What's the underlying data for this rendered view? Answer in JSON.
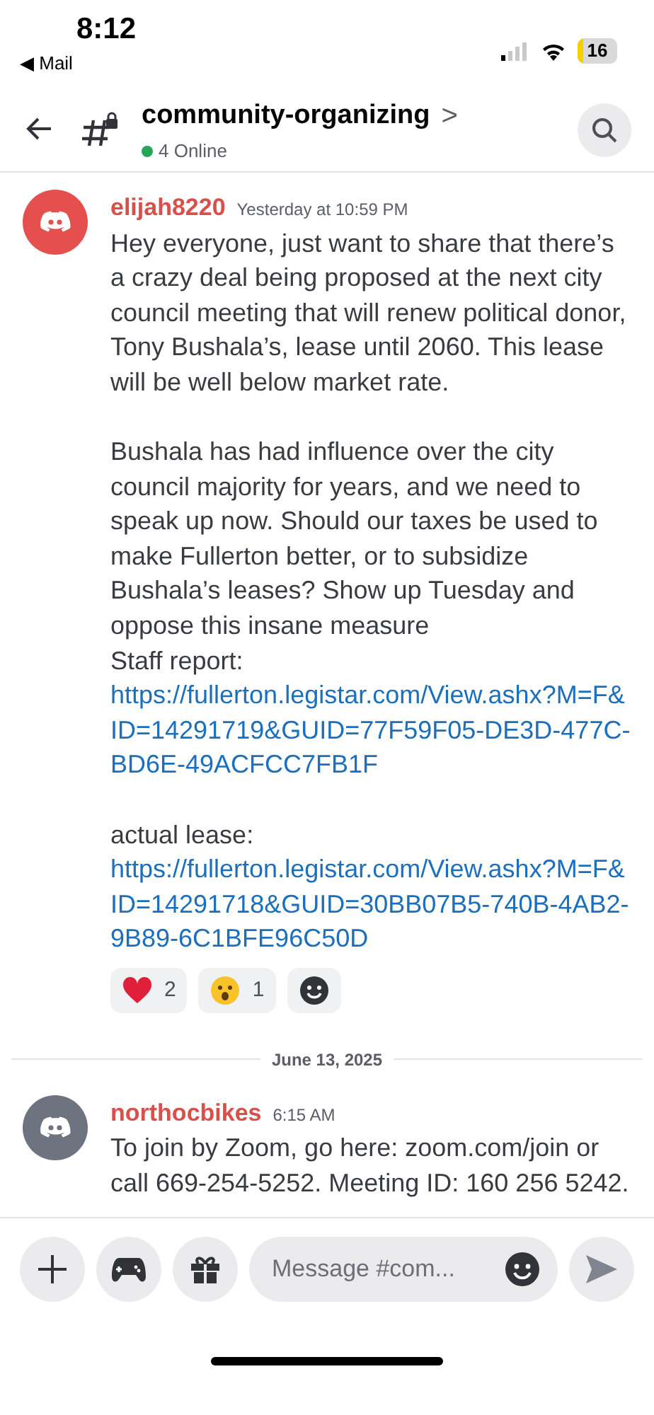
{
  "status_bar": {
    "time": "8:12",
    "back_app": "◀ Mail",
    "battery": "16"
  },
  "header": {
    "channel": "community-organizing",
    "chevron": ">",
    "online": "4 Online"
  },
  "messages": [
    {
      "author": "elijah8220",
      "time": "Yesterday at 10:59 PM",
      "color": "#e5504f",
      "blocks": [
        {
          "kind": "text",
          "text": "Hey everyone, just want to share that there’s a crazy deal being proposed at the next city council meeting that will renew political donor, Tony Bushala’s, lease until 2060. This lease will be well below market rate."
        },
        {
          "kind": "gap"
        },
        {
          "kind": "text",
          "text": "Bushala has had influence over the city council majority for years, and we need to speak up now. Should our taxes be used to make Fullerton better, or to subsidize Bushala’s leases? Show up Tuesday and oppose this insane measure"
        },
        {
          "kind": "link",
          "label": "Staff report:",
          "url": "https://fullerton.legistar.com/View.ashx?M=F&ID=14291719&GUID=77F59F05-DE3D-477C-BD6E-49ACFCC7FB1F"
        },
        {
          "kind": "gap"
        },
        {
          "kind": "link",
          "label": "actual lease:",
          "url": "https://fullerton.legistar.com/View.ashx?M=F&ID=14291718&GUID=30BB07B5-740B-4AB2-9B89-6C1BFE96C50D"
        }
      ],
      "reactions": [
        {
          "kind": "heart",
          "count": "2"
        },
        {
          "kind": "surprised",
          "count": "1"
        },
        {
          "kind": "add"
        }
      ]
    },
    {
      "kind": "date_divider",
      "text": "June 13, 2025"
    },
    {
      "author": "northocbikes",
      "time": "6:15 AM",
      "color": "#6d7480",
      "blocks": [
        {
          "kind": "text",
          "text": "To join by Zoom, go here: zoom.com/join or call 669-254-5252. Meeting ID: 160 256 5242."
        }
      ]
    }
  ],
  "composer": {
    "placeholder": "Message #com..."
  }
}
